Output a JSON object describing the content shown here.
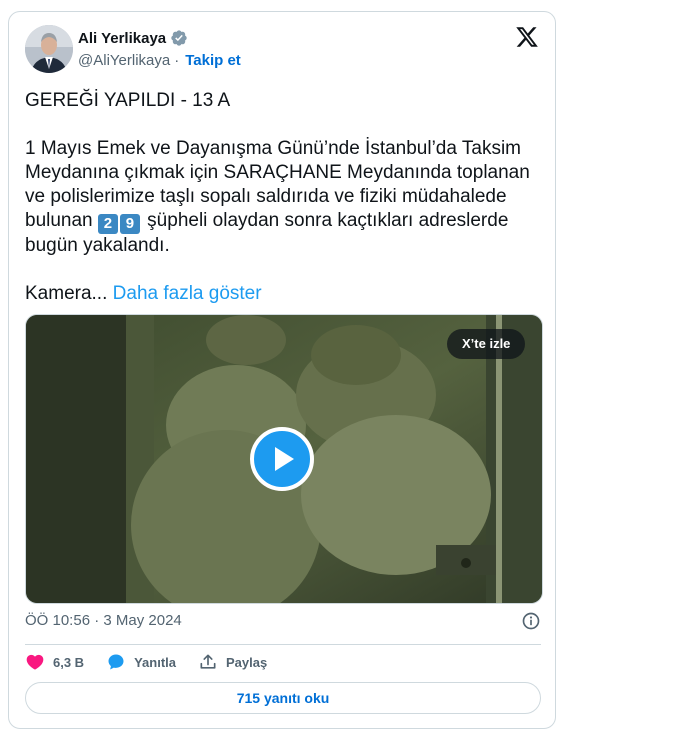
{
  "author": {
    "name": "Ali Yerlikaya",
    "handle": "@AliYerlikaya",
    "separator": "·",
    "follow_label": "Takip et"
  },
  "tweet": {
    "headline": "GEREĞİ YAPILDI - 13 A",
    "body_part1": "1 Mayıs Emek ve Dayanışma Günü’nde İstanbul’da Taksim Meydanına çıkmak için SARAÇHANE Meydanında toplanan ve polislerimize taşlı sopalı saldırıda ve fiziki müdahalede bulunan ",
    "digit_emoji_1": "2",
    "digit_emoji_2": "9",
    "body_part2": " şüpheli olaydan sonra kaçtıkları adreslerde bugün yakalandı.",
    "truncated_text": "Kamera...",
    "show_more_label": "Daha fazla göster"
  },
  "video": {
    "watch_on_x_label": "X’te izle"
  },
  "meta": {
    "timestamp": "ÖÖ 10:56 · 3 May 2024"
  },
  "actions": {
    "likes": "6,3 B",
    "reply_label": "Yanıtla",
    "share_label": "Paylaş"
  },
  "replies_button_label": "715 yanıtı oku",
  "colors": {
    "accent": "#1d9bf0",
    "link": "#006fd6",
    "like": "#f91880",
    "border": "#cfd9de",
    "muted": "#536471"
  }
}
